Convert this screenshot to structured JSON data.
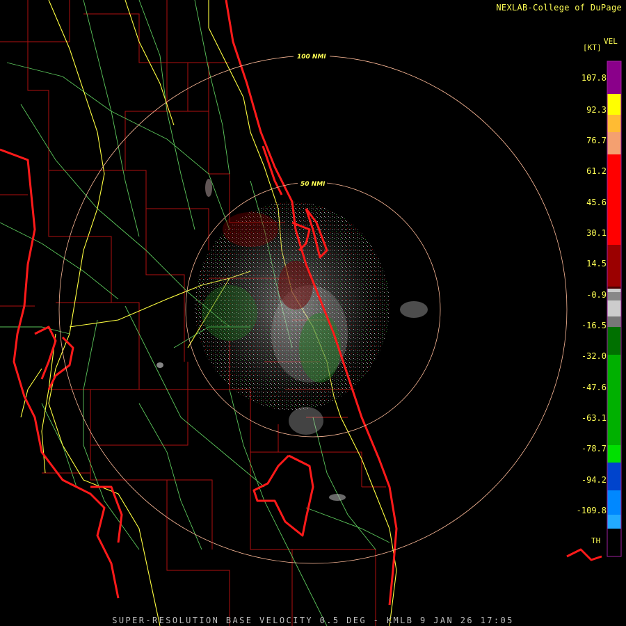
{
  "credit": "NEXLAB-College of DuPage",
  "footer": "SUPER-RESOLUTION BASE VELOCITY 0.5 DEG - KMLB 9 JAN 26 17:05",
  "legend": {
    "product": "VEL",
    "unit": "[KT]",
    "ticks": [
      "107.8",
      "92.3",
      "76.7",
      "61.2",
      "45.6",
      "30.1",
      "14.5",
      "-0.9",
      "-16.5",
      "-32.0",
      "-47.6",
      "-63.1",
      "-78.7",
      "-94.2",
      "-109.8"
    ],
    "threshold_label": "TH"
  },
  "range_rings": [
    {
      "label": "100 NMI"
    },
    {
      "label": "50 NMI"
    }
  ],
  "colors": {
    "background": "#000000",
    "coast": "#ff1a1a",
    "county": "#b01010",
    "roads_primary": "#ffff40",
    "roads_secondary": "#66dd66",
    "rings": "#ffbb99"
  }
}
